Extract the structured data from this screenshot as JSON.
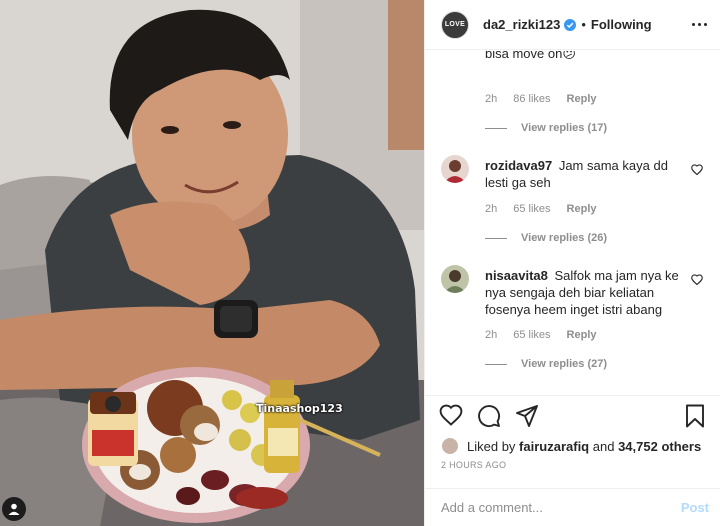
{
  "post": {
    "watermark": "Tinaashop123"
  },
  "header": {
    "avatar_text": "LOVE",
    "username": "da2_rizki123",
    "separator": "•",
    "following_label": "Following"
  },
  "top_comment": {
    "text_tail": "bisa move on😕",
    "time": "2h",
    "likes": "86 likes",
    "reply_label": "Reply",
    "view_replies": "View replies (17)"
  },
  "comments": [
    {
      "username": "rozidava97",
      "text": "Jam sama kaya dd lesti ga seh",
      "time": "2h",
      "likes": "65 likes",
      "reply_label": "Reply",
      "view_replies": "View replies (26)"
    },
    {
      "username": "nisaavita8",
      "text": "Salfok ma jam nya ke nya sengaja deh biar keliatan fosenya heem inget istri abang",
      "time": "2h",
      "likes": "65 likes",
      "reply_label": "Reply",
      "view_replies": "View replies (27)"
    }
  ],
  "likes": {
    "prefix": "Liked by",
    "user": "fairuzarafiq",
    "connector": "and",
    "others": "34,752 others"
  },
  "timestamp": "2 HOURS AGO",
  "comment_box": {
    "placeholder": "Add a comment...",
    "post_label": "Post"
  },
  "colors": {
    "verified_blue": "#3897f0",
    "post_disabled": "#b3dbff",
    "muted_text": "#8e8e8e"
  },
  "icons": [
    "verified-badge-icon",
    "more-options-icon",
    "heart-icon",
    "comment-icon",
    "share-icon",
    "bookmark-icon",
    "user-icon"
  ]
}
